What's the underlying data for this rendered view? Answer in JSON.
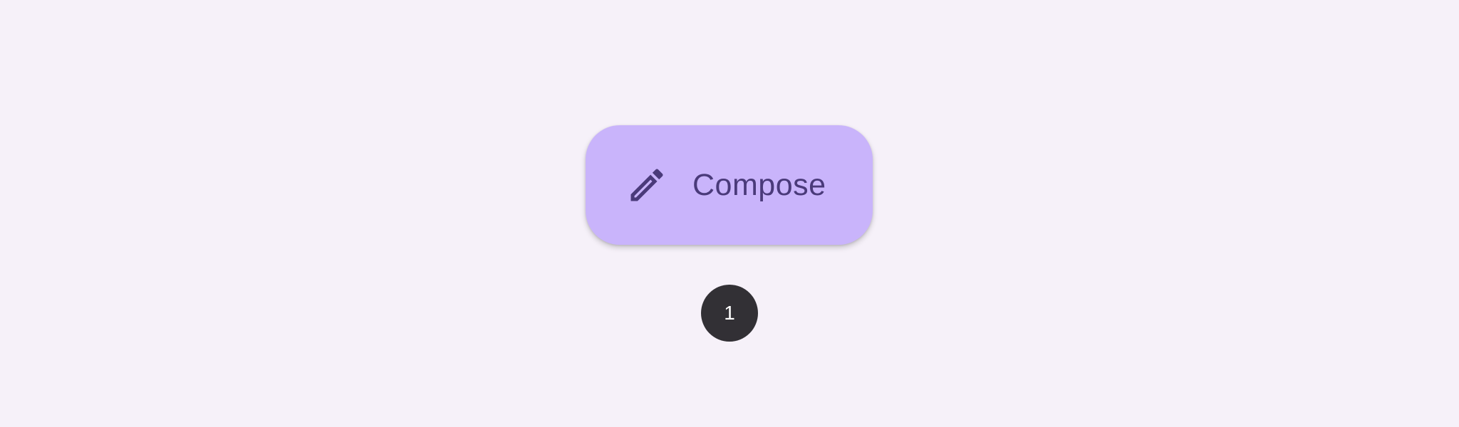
{
  "fab": {
    "label": "Compose",
    "icon": "pencil-icon",
    "background_color": "#c9b4fb",
    "content_color": "#4a3a7a"
  },
  "annotation": {
    "number": "1",
    "background_color": "#323035"
  },
  "page": {
    "background_color": "#f6f1f9"
  }
}
